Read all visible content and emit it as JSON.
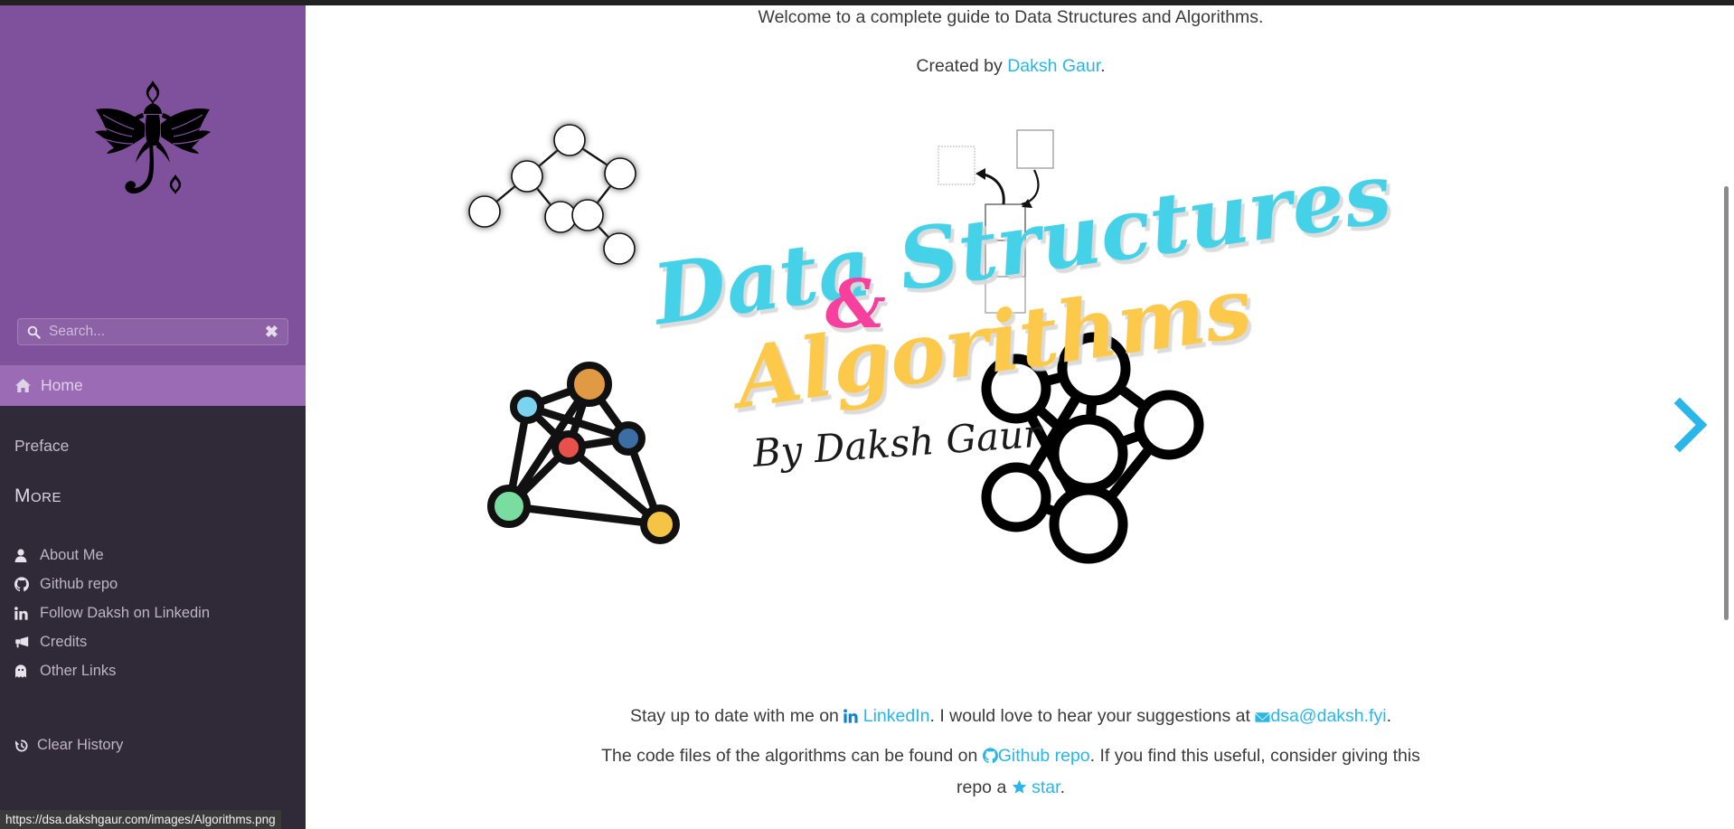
{
  "browser": {
    "status_url": "https://dsa.dakshgaur.com/images/Algorithms.png"
  },
  "sidebar": {
    "logo_name": "dragon-logo",
    "search": {
      "placeholder": "Search...",
      "value": "",
      "clear_label": "✖"
    },
    "active_item": {
      "label": "Home",
      "icon": "home-icon"
    },
    "plain_item": {
      "label": "Preface"
    },
    "section_heading": "More",
    "links": [
      {
        "label": "About Me",
        "icon": "user-icon"
      },
      {
        "label": "Github repo",
        "icon": "github-icon"
      },
      {
        "label": "Follow Daksh on Linkedin",
        "icon": "linkedin-icon"
      },
      {
        "label": "Credits",
        "icon": "bullhorn-icon"
      },
      {
        "label": "Other Links",
        "icon": "ghost-icon"
      }
    ],
    "clear_history": {
      "label": "Clear History",
      "icon": "history-icon"
    }
  },
  "main": {
    "welcome_text": "Welcome to a complete guide to Data Structures and Algorithms.",
    "created_prefix": "Created by ",
    "created_link": "Daksh Gaur",
    "created_suffix": ".",
    "hero": {
      "title_line1": "Data Structures",
      "title_amp": "&",
      "title_line2": "Algorithms",
      "signature": "By Daksh Gaur",
      "title_color_1": "#45d2e8",
      "title_color_amp": "#f73f9e",
      "title_color_2": "#fcc94b",
      "graph_node_colors": [
        "#e09a43",
        "#7bd3ef",
        "#3a6ea5",
        "#e8514b",
        "#79dda0",
        "#f6c council"
      ]
    },
    "stay": {
      "prefix": "Stay up to date with me on ",
      "link1": "LinkedIn",
      "mid": ". I would love to hear your suggestions at ",
      "link2": "dsa@daksh.fyi",
      "suffix": ".",
      "icon1": "linkedin-icon",
      "icon2": "envelope-icon"
    },
    "code": {
      "prefix": "The code files of the algorithms can be found on ",
      "link1": "Github repo",
      "mid": ". If you find this useful, consider giving this",
      "line2_prefix": "repo a ",
      "link2": "star",
      "suffix": ".",
      "icon1": "github-icon",
      "icon2": "star-icon"
    },
    "next_arrow": {
      "name": "next-page-arrow",
      "color": "#29b6e8"
    }
  },
  "colors": {
    "sidebar_purple": "#7f509c",
    "sidebar_active_purple": "#9b6cb5",
    "sidebar_dark": "#302a38",
    "accent_cyan": "#29b6e8"
  }
}
